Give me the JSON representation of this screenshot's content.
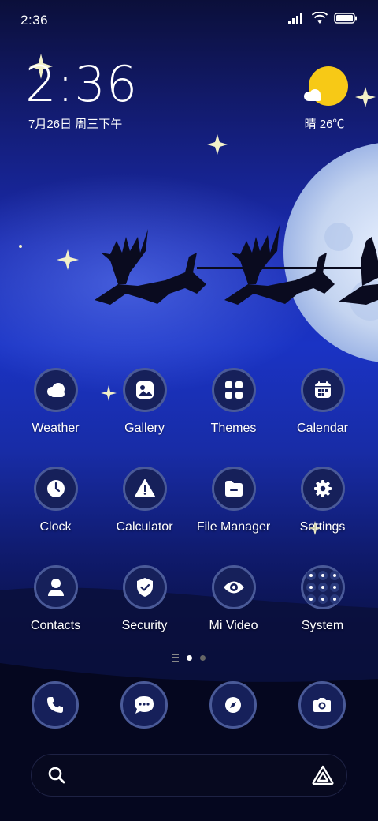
{
  "statusbar": {
    "time": "2:36",
    "icons": [
      "signal-icon",
      "wifi-icon",
      "battery-icon"
    ]
  },
  "clock_widget": {
    "time": "2:36",
    "date": "7月26日 周三下午"
  },
  "weather_widget": {
    "icon": "sun-cloud-icon",
    "text": "晴 26℃"
  },
  "apps": [
    {
      "label": "Weather",
      "icon": "weather-icon"
    },
    {
      "label": "Gallery",
      "icon": "gallery-icon"
    },
    {
      "label": "Themes",
      "icon": "themes-icon"
    },
    {
      "label": "Calendar",
      "icon": "calendar-icon"
    },
    {
      "label": "Clock",
      "icon": "clock-icon"
    },
    {
      "label": "Calculator",
      "icon": "warning-icon"
    },
    {
      "label": "File Manager",
      "icon": "folder-icon"
    },
    {
      "label": "Settings",
      "icon": "gear-icon"
    },
    {
      "label": "Contacts",
      "icon": "person-icon"
    },
    {
      "label": "Security",
      "icon": "shield-icon"
    },
    {
      "label": "Mi Video",
      "icon": "eye-icon"
    },
    {
      "label": "System",
      "icon": "folder-grid-icon"
    }
  ],
  "page_indicator": {
    "pages": 2,
    "active": 1
  },
  "dock": [
    {
      "icon": "phone-icon"
    },
    {
      "icon": "message-icon"
    },
    {
      "icon": "compass-icon"
    },
    {
      "icon": "camera-icon"
    }
  ],
  "search_bar": {
    "left_icon": "search-icon",
    "right_icon": "assistant-icon"
  },
  "colors": {
    "icon_bg": "#16205a",
    "icon_ring": "#4a5a98",
    "sun": "#f7c916",
    "moon": "#c9d8f2"
  }
}
